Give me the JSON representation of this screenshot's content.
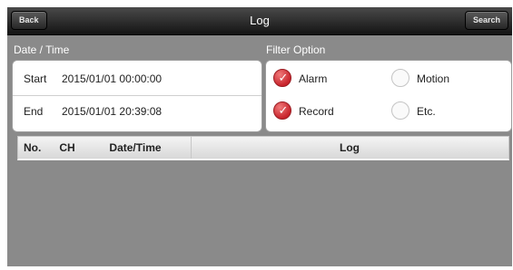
{
  "topbar": {
    "back_label": "Back",
    "title": "Log",
    "search_label": "Search"
  },
  "datetime": {
    "label": "Date / Time",
    "start_label": "Start",
    "start_value": "2015/01/01 00:00:00",
    "end_label": "End",
    "end_value": "2015/01/01 20:39:08"
  },
  "filter": {
    "label": "Filter Option",
    "options": [
      {
        "label": "Alarm",
        "checked": true
      },
      {
        "label": "Motion",
        "checked": false
      },
      {
        "label": "Record",
        "checked": true
      },
      {
        "label": "Etc.",
        "checked": false
      }
    ]
  },
  "table": {
    "columns": [
      "No.",
      "CH",
      "Date/Time",
      "Log"
    ]
  },
  "colors": {
    "checked": "#c8242c",
    "background": "#8a8a8a"
  }
}
